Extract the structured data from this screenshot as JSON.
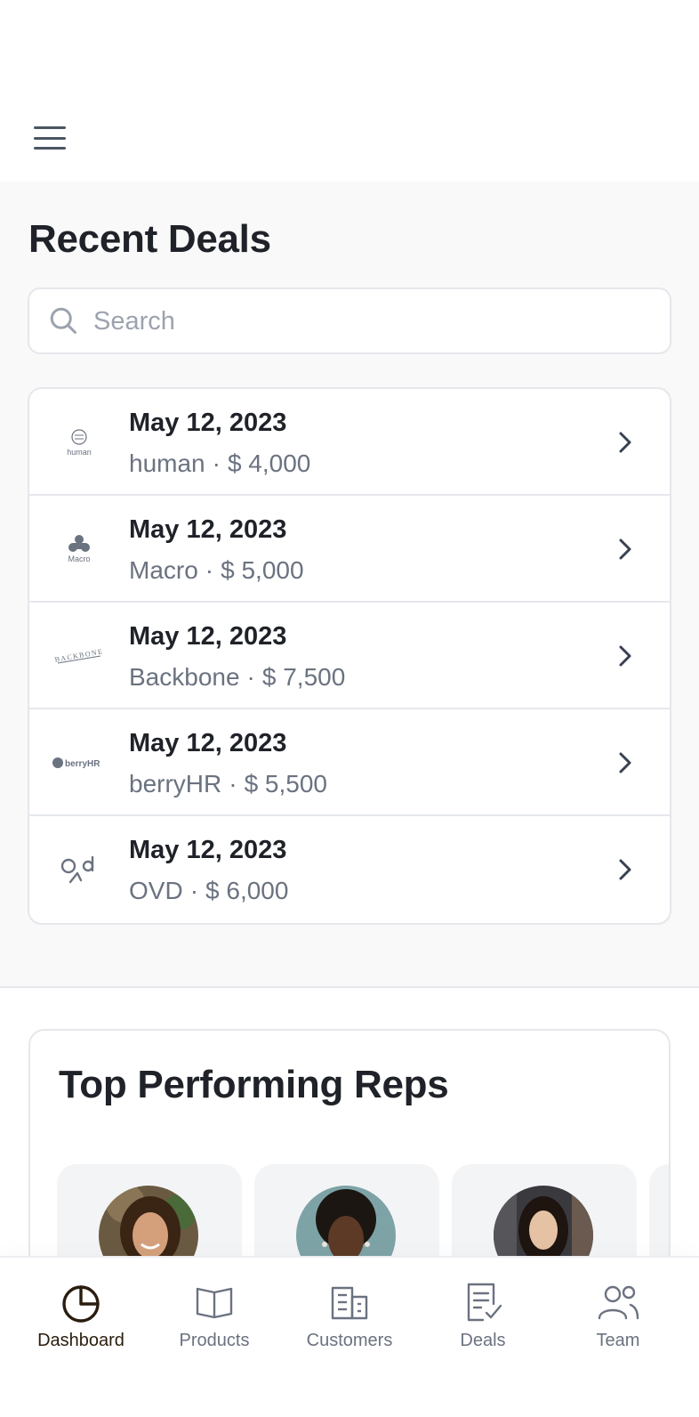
{
  "header": {
    "menu_icon": "hamburger-menu-icon"
  },
  "recent_deals": {
    "title": "Recent Deals",
    "search": {
      "placeholder": "Search",
      "value": "",
      "icon": "search-icon"
    },
    "deals": [
      {
        "date": "May 12, 2023",
        "company": "human",
        "amount": "$ 4,000",
        "logo_text": "human"
      },
      {
        "date": "May 12, 2023",
        "company": "Macro",
        "amount": "$ 5,000",
        "logo_text": "Macro"
      },
      {
        "date": "May 12, 2023",
        "company": "Backbone",
        "amount": "$ 7,500",
        "logo_text": "BACKBONE"
      },
      {
        "date": "May 12, 2023",
        "company": "berryHR",
        "amount": "$ 5,500",
        "logo_text": "berryHR"
      },
      {
        "date": "May 12, 2023",
        "company": "OVD",
        "amount": "$ 6,000",
        "logo_text": ""
      }
    ],
    "separator": "·"
  },
  "top_reps": {
    "title": "Top Performing Reps"
  },
  "bottom_nav": {
    "items": [
      {
        "label": "Dashboard",
        "icon": "pie-chart-icon",
        "active": true
      },
      {
        "label": "Products",
        "icon": "book-open-icon",
        "active": false
      },
      {
        "label": "Customers",
        "icon": "building-icon",
        "active": false
      },
      {
        "label": "Deals",
        "icon": "document-check-icon",
        "active": false
      },
      {
        "label": "Team",
        "icon": "users-icon",
        "active": false
      }
    ]
  },
  "colors": {
    "active_nav": "#2a1d0e",
    "muted_text": "#6b7280",
    "section_bg": "#f9f9fa"
  }
}
